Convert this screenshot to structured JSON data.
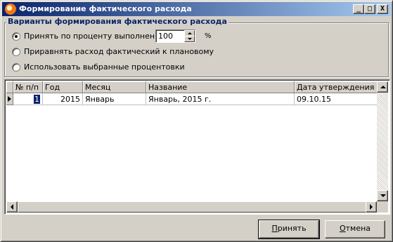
{
  "window": {
    "title": "Формирование фактического расхода",
    "buttons": {
      "minimize": "_",
      "maximize": "□",
      "close": "X"
    }
  },
  "options": {
    "legend": "Варианты формирования фактического расхода",
    "items": [
      {
        "label": "Принять по проценту выполнения",
        "checked": true
      },
      {
        "label": "Приравнять расход фактический к плановому",
        "checked": false
      },
      {
        "label": "Использовать выбранные процентовки",
        "checked": false
      }
    ],
    "percent_value": "100",
    "percent_sign": "%"
  },
  "grid": {
    "columns": [
      "№ п/п",
      "Год",
      "Месяц",
      "Название",
      "Дата утверждения"
    ],
    "rows": [
      {
        "num": "1",
        "year": "2015",
        "month": "Январь",
        "name": "Январь, 2015 г.",
        "date": "09.10.15"
      }
    ]
  },
  "buttons": {
    "accept": {
      "first": "П",
      "rest": "ринять"
    },
    "cancel": {
      "first": "О",
      "rest": "тмена"
    }
  }
}
